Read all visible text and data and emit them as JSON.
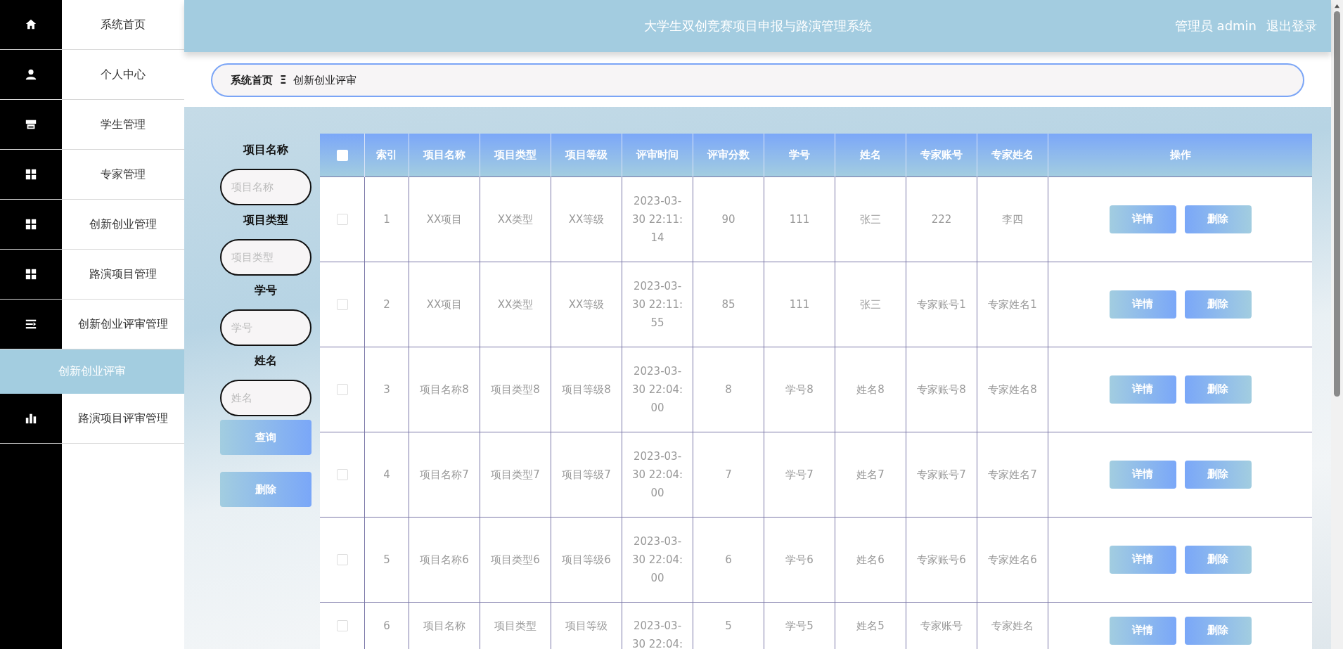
{
  "sidebar": {
    "items": [
      {
        "label": "系统首页",
        "kind": "home",
        "selected": false
      },
      {
        "label": "个人中心",
        "kind": "user",
        "selected": false
      },
      {
        "label": "学生管理",
        "kind": "store",
        "selected": false
      },
      {
        "label": "专家管理",
        "kind": "grid",
        "selected": false
      },
      {
        "label": "创新创业管理",
        "kind": "grid",
        "selected": false
      },
      {
        "label": "路演项目管理",
        "kind": "grid",
        "selected": false
      },
      {
        "label": "创新创业评审管理",
        "kind": "list",
        "selected": false,
        "expanded": true,
        "children": [
          {
            "label": "创新创业评审",
            "selected": true
          }
        ]
      },
      {
        "label": "路演项目评审管理",
        "kind": "chart",
        "selected": false
      }
    ]
  },
  "header": {
    "title": "大学生双创竞赛项目申报与路演管理系统",
    "user": "管理员 admin",
    "logout": "退出登录"
  },
  "breadcrumb": {
    "items": [
      "系统首页",
      "创新创业评审"
    ],
    "separator": "Ξ"
  },
  "search": {
    "fields": [
      {
        "label": "项目名称",
        "placeholder": "项目名称"
      },
      {
        "label": "项目类型",
        "placeholder": "项目类型"
      },
      {
        "label": "学号",
        "placeholder": "学号"
      },
      {
        "label": "姓名",
        "placeholder": "姓名"
      }
    ],
    "buttons": [
      "查询",
      "删除"
    ]
  },
  "table": {
    "select_all_checked": false,
    "columns": [
      "索引",
      "项目名称",
      "项目类型",
      "项目等级",
      "评审时间",
      "评审分数",
      "学号",
      "姓名",
      "专家账号",
      "专家姓名",
      "操作"
    ],
    "rows": [
      {
        "checked": false,
        "cells": [
          "1",
          "XX项目",
          "XX类型",
          "XX等级",
          "2023-03-30 22:11:14",
          "90",
          "111",
          "张三",
          "222",
          "李四"
        ],
        "actions": [
          "详情",
          "删除"
        ]
      },
      {
        "checked": false,
        "cells": [
          "2",
          "XX项目",
          "XX类型",
          "XX等级",
          "2023-03-30 22:11:55",
          "85",
          "111",
          "张三",
          "专家账号1",
          "专家姓名1"
        ],
        "actions": [
          "详情",
          "删除"
        ]
      },
      {
        "checked": false,
        "cells": [
          "3",
          "项目名称8",
          "项目类型8",
          "项目等级8",
          "2023-03-30 22:04:00",
          "8",
          "学号8",
          "姓名8",
          "专家账号8",
          "专家姓名8"
        ],
        "actions": [
          "详情",
          "删除"
        ]
      },
      {
        "checked": false,
        "cells": [
          "4",
          "项目名称7",
          "项目类型7",
          "项目等级7",
          "2023-03-30 22:04:00",
          "7",
          "学号7",
          "姓名7",
          "专家账号7",
          "专家姓名7"
        ],
        "actions": [
          "详情",
          "删除"
        ]
      },
      {
        "checked": false,
        "cells": [
          "5",
          "项目名称6",
          "项目类型6",
          "项目等级6",
          "2023-03-30 22:04:00",
          "6",
          "学号6",
          "姓名6",
          "专家账号6",
          "专家姓名6"
        ],
        "actions": [
          "详情",
          "删除"
        ]
      },
      {
        "checked": false,
        "cells": [
          "6",
          "项目名称",
          "项目类型",
          "项目等级",
          "2023-03-30 22:04:",
          "5",
          "学号5",
          "姓名5",
          "专家账号",
          "专家姓名"
        ],
        "actions": [
          "详情",
          "删除"
        ]
      }
    ]
  }
}
